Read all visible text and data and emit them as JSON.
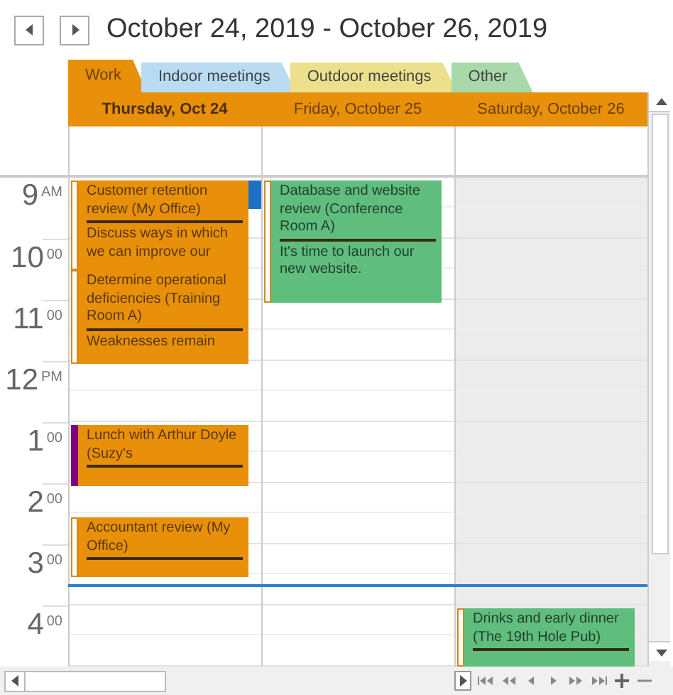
{
  "title": "October 24, 2019 - October 26, 2019",
  "tabs": [
    {
      "label": "Work",
      "selected": true,
      "color": "#e8900a"
    },
    {
      "label": "Indoor meetings",
      "selected": false,
      "color": "#b9dcf2"
    },
    {
      "label": "Outdoor meetings",
      "selected": false,
      "color": "#ede08c"
    },
    {
      "label": "Other",
      "selected": false,
      "color": "#a9d9aa"
    }
  ],
  "days": [
    {
      "label": "Thursday, Oct 24",
      "selected": true,
      "weekend": false,
      "events": [
        {
          "title": "Customer retention review (My Office)",
          "description": "Discuss ways in which we can improve our",
          "color": "#e8900a",
          "kind": "free"
        },
        {
          "title": "Determine operational deficiencies (Training Room A)",
          "description": "Weaknesses remain",
          "color": "#e8900a",
          "kind": "free"
        },
        {
          "title": "Lunch with Arthur Doyle (Suzy's",
          "color": "#e8900a",
          "kind": "away"
        },
        {
          "title": "Accountant review (My Office)",
          "color": "#e8900a",
          "kind": "free"
        }
      ]
    },
    {
      "label": "Friday, October 25",
      "selected": false,
      "weekend": false,
      "events": [
        {
          "title": "Database and website review (Conference Room A)",
          "description": "It's time to launch our new website.",
          "color": "#5fbd7e",
          "kind": "free"
        }
      ]
    },
    {
      "label": "Saturday, October 26",
      "selected": false,
      "weekend": true,
      "events": [
        {
          "title": "Drinks and early dinner (The 19th Hole Pub)",
          "color": "#5fbd7e",
          "kind": "free"
        }
      ]
    }
  ],
  "hours": [
    {
      "hour": "9",
      "suffix": "AM"
    },
    {
      "hour": "10",
      "suffix": "00"
    },
    {
      "hour": "11",
      "suffix": "00"
    },
    {
      "hour": "12",
      "suffix": "PM"
    },
    {
      "hour": "1",
      "suffix": "00"
    },
    {
      "hour": "2",
      "suffix": "00"
    },
    {
      "hour": "3",
      "suffix": "00"
    },
    {
      "hour": "4",
      "suffix": "00"
    }
  ]
}
